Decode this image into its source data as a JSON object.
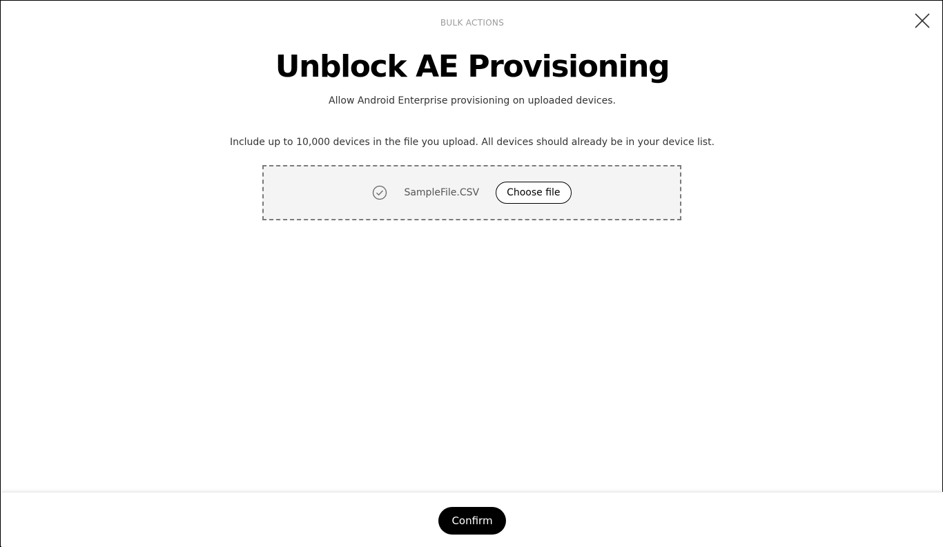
{
  "header": {
    "eyebrow": "BULK ACTIONS",
    "title": "Unblock AE Provisioning",
    "subtitle": "Allow Android Enterprise provisioning on uploaded devices."
  },
  "upload": {
    "instruction": "Include up to 10,000 devices in the file you upload. All devices should already be in your device list.",
    "file_name": "SampleFile.CSV",
    "choose_label": "Choose file",
    "status_icon": "check-circle-icon"
  },
  "footer": {
    "confirm_label": "Confirm"
  },
  "icons": {
    "close": "close-icon"
  },
  "colors": {
    "primary": "#000000",
    "dropzone_bg": "#f4f4f4",
    "dropzone_border": "#7a7a7a",
    "muted_text": "#9a9a9a"
  }
}
